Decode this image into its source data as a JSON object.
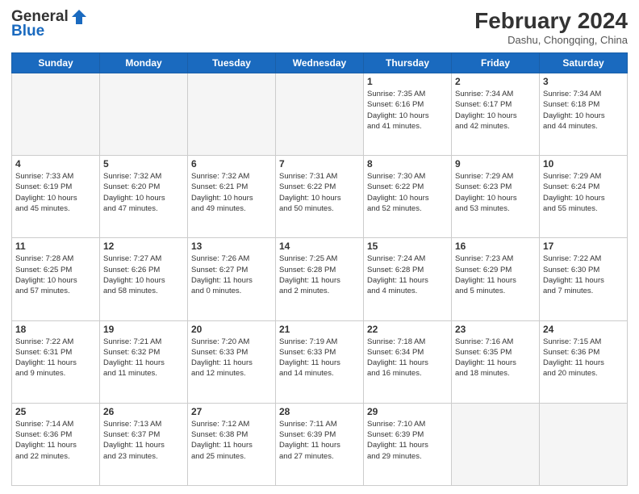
{
  "header": {
    "logo_general": "General",
    "logo_blue": "Blue",
    "month_year": "February 2024",
    "location": "Dashu, Chongqing, China"
  },
  "weekdays": [
    "Sunday",
    "Monday",
    "Tuesday",
    "Wednesday",
    "Thursday",
    "Friday",
    "Saturday"
  ],
  "weeks": [
    [
      {
        "day": "",
        "info": ""
      },
      {
        "day": "",
        "info": ""
      },
      {
        "day": "",
        "info": ""
      },
      {
        "day": "",
        "info": ""
      },
      {
        "day": "1",
        "info": "Sunrise: 7:35 AM\nSunset: 6:16 PM\nDaylight: 10 hours\nand 41 minutes."
      },
      {
        "day": "2",
        "info": "Sunrise: 7:34 AM\nSunset: 6:17 PM\nDaylight: 10 hours\nand 42 minutes."
      },
      {
        "day": "3",
        "info": "Sunrise: 7:34 AM\nSunset: 6:18 PM\nDaylight: 10 hours\nand 44 minutes."
      }
    ],
    [
      {
        "day": "4",
        "info": "Sunrise: 7:33 AM\nSunset: 6:19 PM\nDaylight: 10 hours\nand 45 minutes."
      },
      {
        "day": "5",
        "info": "Sunrise: 7:32 AM\nSunset: 6:20 PM\nDaylight: 10 hours\nand 47 minutes."
      },
      {
        "day": "6",
        "info": "Sunrise: 7:32 AM\nSunset: 6:21 PM\nDaylight: 10 hours\nand 49 minutes."
      },
      {
        "day": "7",
        "info": "Sunrise: 7:31 AM\nSunset: 6:22 PM\nDaylight: 10 hours\nand 50 minutes."
      },
      {
        "day": "8",
        "info": "Sunrise: 7:30 AM\nSunset: 6:22 PM\nDaylight: 10 hours\nand 52 minutes."
      },
      {
        "day": "9",
        "info": "Sunrise: 7:29 AM\nSunset: 6:23 PM\nDaylight: 10 hours\nand 53 minutes."
      },
      {
        "day": "10",
        "info": "Sunrise: 7:29 AM\nSunset: 6:24 PM\nDaylight: 10 hours\nand 55 minutes."
      }
    ],
    [
      {
        "day": "11",
        "info": "Sunrise: 7:28 AM\nSunset: 6:25 PM\nDaylight: 10 hours\nand 57 minutes."
      },
      {
        "day": "12",
        "info": "Sunrise: 7:27 AM\nSunset: 6:26 PM\nDaylight: 10 hours\nand 58 minutes."
      },
      {
        "day": "13",
        "info": "Sunrise: 7:26 AM\nSunset: 6:27 PM\nDaylight: 11 hours\nand 0 minutes."
      },
      {
        "day": "14",
        "info": "Sunrise: 7:25 AM\nSunset: 6:28 PM\nDaylight: 11 hours\nand 2 minutes."
      },
      {
        "day": "15",
        "info": "Sunrise: 7:24 AM\nSunset: 6:28 PM\nDaylight: 11 hours\nand 4 minutes."
      },
      {
        "day": "16",
        "info": "Sunrise: 7:23 AM\nSunset: 6:29 PM\nDaylight: 11 hours\nand 5 minutes."
      },
      {
        "day": "17",
        "info": "Sunrise: 7:22 AM\nSunset: 6:30 PM\nDaylight: 11 hours\nand 7 minutes."
      }
    ],
    [
      {
        "day": "18",
        "info": "Sunrise: 7:22 AM\nSunset: 6:31 PM\nDaylight: 11 hours\nand 9 minutes."
      },
      {
        "day": "19",
        "info": "Sunrise: 7:21 AM\nSunset: 6:32 PM\nDaylight: 11 hours\nand 11 minutes."
      },
      {
        "day": "20",
        "info": "Sunrise: 7:20 AM\nSunset: 6:33 PM\nDaylight: 11 hours\nand 12 minutes."
      },
      {
        "day": "21",
        "info": "Sunrise: 7:19 AM\nSunset: 6:33 PM\nDaylight: 11 hours\nand 14 minutes."
      },
      {
        "day": "22",
        "info": "Sunrise: 7:18 AM\nSunset: 6:34 PM\nDaylight: 11 hours\nand 16 minutes."
      },
      {
        "day": "23",
        "info": "Sunrise: 7:16 AM\nSunset: 6:35 PM\nDaylight: 11 hours\nand 18 minutes."
      },
      {
        "day": "24",
        "info": "Sunrise: 7:15 AM\nSunset: 6:36 PM\nDaylight: 11 hours\nand 20 minutes."
      }
    ],
    [
      {
        "day": "25",
        "info": "Sunrise: 7:14 AM\nSunset: 6:36 PM\nDaylight: 11 hours\nand 22 minutes."
      },
      {
        "day": "26",
        "info": "Sunrise: 7:13 AM\nSunset: 6:37 PM\nDaylight: 11 hours\nand 23 minutes."
      },
      {
        "day": "27",
        "info": "Sunrise: 7:12 AM\nSunset: 6:38 PM\nDaylight: 11 hours\nand 25 minutes."
      },
      {
        "day": "28",
        "info": "Sunrise: 7:11 AM\nSunset: 6:39 PM\nDaylight: 11 hours\nand 27 minutes."
      },
      {
        "day": "29",
        "info": "Sunrise: 7:10 AM\nSunset: 6:39 PM\nDaylight: 11 hours\nand 29 minutes."
      },
      {
        "day": "",
        "info": ""
      },
      {
        "day": "",
        "info": ""
      }
    ]
  ]
}
